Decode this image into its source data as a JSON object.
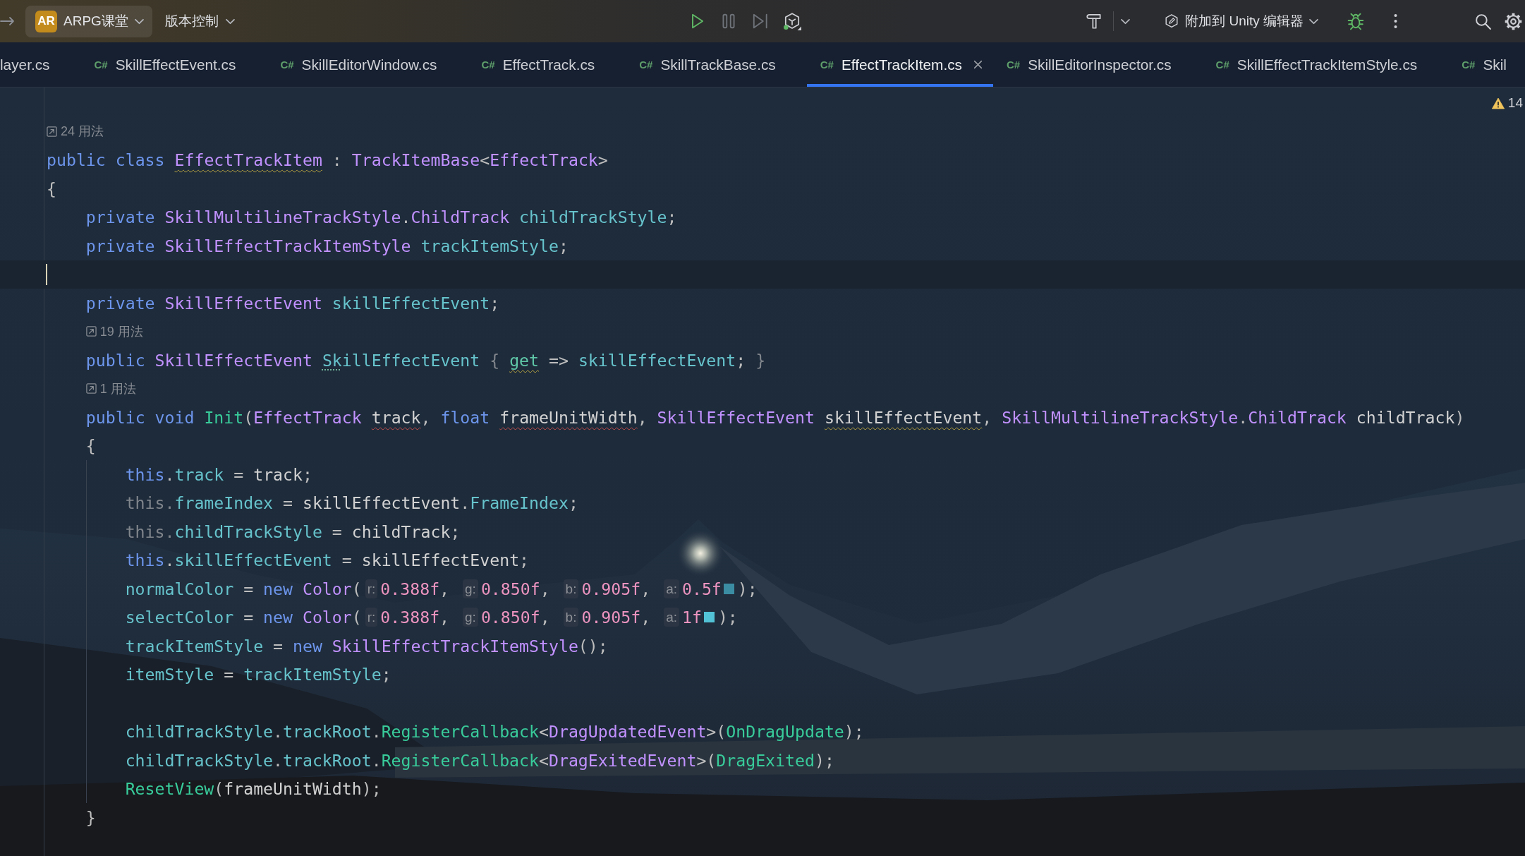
{
  "toolbar": {
    "project": {
      "initials": "AR",
      "name": "ARPG课堂"
    },
    "vcs_menu": "版本控制",
    "run_controls": [
      {
        "kind": "run",
        "disabled": false
      },
      {
        "kind": "pause",
        "disabled": true
      },
      {
        "kind": "step",
        "disabled": true
      }
    ],
    "run_configuration": "附加到 Unity 编辑器"
  },
  "tabs": [
    {
      "kind": "clipped",
      "label": "layer.cs",
      "selected": false
    },
    {
      "kind": "file",
      "file_type": "C#",
      "label": "SkillEffectEvent.cs",
      "selected": false
    },
    {
      "kind": "file",
      "file_type": "C#",
      "label": "SkillEditorWindow.cs",
      "selected": false
    },
    {
      "kind": "file",
      "file_type": "C#",
      "label": "EffectTrack.cs",
      "selected": false
    },
    {
      "kind": "file",
      "file_type": "C#",
      "label": "SkillTrackBase.cs",
      "selected": false
    },
    {
      "kind": "file",
      "file_type": "C#",
      "label": "EffectTrackItem.cs",
      "selected": true
    },
    {
      "kind": "file",
      "file_type": "C#",
      "label": "SkillEditorInspector.cs",
      "selected": false
    },
    {
      "kind": "file",
      "file_type": "C#",
      "label": "SkillEffectTrackItemStyle.cs",
      "selected": false
    },
    {
      "kind": "file",
      "file_type": "C#",
      "label": "Skil",
      "selected": false
    }
  ],
  "editor": {
    "warning_count": "14",
    "lines": [
      {
        "kind": "hint",
        "text": "24 用法"
      },
      {
        "kind": "code",
        "tokens": [
          {
            "text": "public ",
            "kind": "keyword"
          },
          {
            "text": "class ",
            "kind": "keyword"
          },
          {
            "text": "EffectTrackItem",
            "kind": "type",
            "underline": {
              "kind": "warning"
            }
          },
          {
            "text": " : ",
            "kind": "punct"
          },
          {
            "text": "TrackItemBase",
            "kind": "type"
          },
          {
            "text": "<",
            "kind": "punct"
          },
          {
            "text": "EffectTrack",
            "kind": "type"
          },
          {
            "text": ">",
            "kind": "punct"
          }
        ]
      },
      {
        "kind": "code",
        "tokens": [
          {
            "text": "{",
            "kind": "punct"
          }
        ],
        "children": [
          {
            "kind": "code",
            "tokens": [
              {
                "text": "private ",
                "kind": "keyword"
              },
              {
                "text": "SkillMultilineTrackStyle",
                "kind": "type"
              },
              {
                "text": ".",
                "kind": "punct"
              },
              {
                "text": "ChildTrack ",
                "kind": "type"
              },
              {
                "text": "childTrackStyle",
                "kind": "field"
              },
              {
                "text": ";",
                "kind": "punct"
              }
            ]
          },
          {
            "kind": "code",
            "tokens": [
              {
                "text": "private ",
                "kind": "keyword"
              },
              {
                "text": "SkillEffectTrackItemStyle ",
                "kind": "type"
              },
              {
                "text": "trackItemStyle",
                "kind": "field"
              },
              {
                "text": ";",
                "kind": "punct"
              }
            ]
          },
          {
            "kind": "blank",
            "caret": true
          },
          {
            "kind": "code",
            "tokens": [
              {
                "text": "private ",
                "kind": "keyword"
              },
              {
                "text": "SkillEffectEvent ",
                "kind": "type"
              },
              {
                "text": "skillEffectEvent",
                "kind": "field"
              },
              {
                "text": ";",
                "kind": "punct"
              }
            ]
          },
          {
            "kind": "hint",
            "text": "19 用法"
          },
          {
            "kind": "code",
            "tokens": [
              {
                "text": "public ",
                "kind": "keyword"
              },
              {
                "text": "SkillEffectEvent ",
                "kind": "type"
              },
              {
                "text": "Sk",
                "kind": "field",
                "underline": {
                  "kind": "dotted"
                }
              },
              {
                "text": "illEffectEvent ",
                "kind": "field"
              },
              {
                "text": "{ ",
                "kind": "dim"
              },
              {
                "text": "get",
                "kind": "accessor",
                "underline": {
                  "kind": "warning"
                }
              },
              {
                "text": " => ",
                "kind": "punct"
              },
              {
                "text": "skillEffectEvent",
                "kind": "field"
              },
              {
                "text": "; ",
                "kind": "punct"
              },
              {
                "text": "}",
                "kind": "dim"
              }
            ]
          },
          {
            "kind": "hint",
            "text": "1 用法"
          },
          {
            "kind": "code",
            "tokens": [
              {
                "text": "public ",
                "kind": "keyword"
              },
              {
                "text": "void ",
                "kind": "keyword"
              },
              {
                "text": "Init",
                "kind": "method"
              },
              {
                "text": "(",
                "kind": "punct"
              },
              {
                "text": "EffectTrack ",
                "kind": "type"
              },
              {
                "text": "track",
                "kind": "param",
                "underline": {
                  "kind": "error"
                }
              },
              {
                "text": ", ",
                "kind": "punct"
              },
              {
                "text": "float ",
                "kind": "keyword"
              },
              {
                "text": "frameUnitWidth",
                "kind": "param",
                "underline": {
                  "kind": "error"
                }
              },
              {
                "text": ", ",
                "kind": "punct"
              },
              {
                "text": "SkillEffectEvent ",
                "kind": "type"
              },
              {
                "text": "skillEffectEvent",
                "kind": "param",
                "underline": {
                  "kind": "warning"
                }
              },
              {
                "text": ", ",
                "kind": "punct"
              },
              {
                "text": "SkillMultilineTrackStyle",
                "kind": "type"
              },
              {
                "text": ".",
                "kind": "punct"
              },
              {
                "text": "ChildTrack ",
                "kind": "type"
              },
              {
                "text": "childTrack",
                "kind": "param"
              },
              {
                "text": ")",
                "kind": "punct"
              }
            ]
          },
          {
            "kind": "code",
            "tokens": [
              {
                "text": "{",
                "kind": "punct"
              }
            ],
            "children": [
              {
                "kind": "code",
                "tokens": [
                  {
                    "text": "this",
                    "kind": "keyword"
                  },
                  {
                    "text": ".",
                    "kind": "punct"
                  },
                  {
                    "text": "track",
                    "kind": "field"
                  },
                  {
                    "text": " = ",
                    "kind": "punct"
                  },
                  {
                    "text": "track",
                    "kind": "param"
                  },
                  {
                    "text": ";",
                    "kind": "punct"
                  }
                ]
              },
              {
                "kind": "code",
                "tokens": [
                  {
                    "text": "this.",
                    "kind": "dim"
                  },
                  {
                    "text": "frameIndex",
                    "kind": "field"
                  },
                  {
                    "text": " = ",
                    "kind": "punct"
                  },
                  {
                    "text": "skillEffectEvent",
                    "kind": "param"
                  },
                  {
                    "text": ".",
                    "kind": "punct"
                  },
                  {
                    "text": "FrameIndex",
                    "kind": "field"
                  },
                  {
                    "text": ";",
                    "kind": "punct"
                  }
                ]
              },
              {
                "kind": "code",
                "tokens": [
                  {
                    "text": "this.",
                    "kind": "dim"
                  },
                  {
                    "text": "childTrackStyle",
                    "kind": "field"
                  },
                  {
                    "text": " = ",
                    "kind": "punct"
                  },
                  {
                    "text": "childTrack",
                    "kind": "param"
                  },
                  {
                    "text": ";",
                    "kind": "punct"
                  }
                ]
              },
              {
                "kind": "code",
                "tokens": [
                  {
                    "text": "this",
                    "kind": "keyword"
                  },
                  {
                    "text": ".",
                    "kind": "punct"
                  },
                  {
                    "text": "skillEffectEvent",
                    "kind": "field"
                  },
                  {
                    "text": " = ",
                    "kind": "punct"
                  },
                  {
                    "text": "skillEffectEvent",
                    "kind": "param"
                  },
                  {
                    "text": ";",
                    "kind": "punct"
                  }
                ]
              },
              {
                "kind": "code",
                "tokens": [
                  {
                    "text": "normalColor",
                    "kind": "field"
                  },
                  {
                    "text": " = ",
                    "kind": "punct"
                  },
                  {
                    "text": "new ",
                    "kind": "keyword"
                  },
                  {
                    "text": "Color",
                    "kind": "type"
                  },
                  {
                    "text": "(",
                    "kind": "punct"
                  },
                  {
                    "text": "r:",
                    "kind": "inlay"
                  },
                  {
                    "text": "0.388f",
                    "kind": "number"
                  },
                  {
                    "text": ", ",
                    "kind": "punct"
                  },
                  {
                    "text": "g:",
                    "kind": "inlay"
                  },
                  {
                    "text": "0.850f",
                    "kind": "number"
                  },
                  {
                    "text": ", ",
                    "kind": "punct"
                  },
                  {
                    "text": "b:",
                    "kind": "inlay"
                  },
                  {
                    "text": "0.905f",
                    "kind": "number"
                  },
                  {
                    "text": ", ",
                    "kind": "punct"
                  },
                  {
                    "text": "a:",
                    "kind": "inlay"
                  },
                  {
                    "text": "0.5f",
                    "kind": "number"
                  },
                  {
                    "kind": "swatch",
                    "color": "#3b8da3"
                  },
                  {
                    "text": ");",
                    "kind": "punct"
                  }
                ]
              },
              {
                "kind": "code",
                "tokens": [
                  {
                    "text": "selectColor",
                    "kind": "field"
                  },
                  {
                    "text": " = ",
                    "kind": "punct"
                  },
                  {
                    "text": "new ",
                    "kind": "keyword"
                  },
                  {
                    "text": "Color",
                    "kind": "type"
                  },
                  {
                    "text": "(",
                    "kind": "punct"
                  },
                  {
                    "text": "r:",
                    "kind": "inlay"
                  },
                  {
                    "text": "0.388f",
                    "kind": "number"
                  },
                  {
                    "text": ", ",
                    "kind": "punct"
                  },
                  {
                    "text": "g:",
                    "kind": "inlay"
                  },
                  {
                    "text": "0.850f",
                    "kind": "number"
                  },
                  {
                    "text": ", ",
                    "kind": "punct"
                  },
                  {
                    "text": "b:",
                    "kind": "inlay"
                  },
                  {
                    "text": "0.905f",
                    "kind": "number"
                  },
                  {
                    "text": ", ",
                    "kind": "punct"
                  },
                  {
                    "text": "a:",
                    "kind": "inlay"
                  },
                  {
                    "text": "1f",
                    "kind": "number"
                  },
                  {
                    "kind": "swatch",
                    "color": "#52c3d6"
                  },
                  {
                    "text": ");",
                    "kind": "punct"
                  }
                ]
              },
              {
                "kind": "code",
                "tokens": [
                  {
                    "text": "trackItemStyle",
                    "kind": "field"
                  },
                  {
                    "text": " = ",
                    "kind": "punct"
                  },
                  {
                    "text": "new ",
                    "kind": "keyword"
                  },
                  {
                    "text": "SkillEffectTrackItemStyle",
                    "kind": "type"
                  },
                  {
                    "text": "();",
                    "kind": "punct"
                  }
                ]
              },
              {
                "kind": "code",
                "tokens": [
                  {
                    "text": "itemStyle",
                    "kind": "field"
                  },
                  {
                    "text": " = ",
                    "kind": "punct"
                  },
                  {
                    "text": "trackItemStyle",
                    "kind": "field"
                  },
                  {
                    "text": ";",
                    "kind": "punct"
                  }
                ]
              },
              {
                "kind": "blank",
                "caret": false
              },
              {
                "kind": "code",
                "tokens": [
                  {
                    "text": "childTrackStyle",
                    "kind": "field"
                  },
                  {
                    "text": ".",
                    "kind": "punct"
                  },
                  {
                    "text": "trackRoot",
                    "kind": "field"
                  },
                  {
                    "text": ".",
                    "kind": "punct"
                  },
                  {
                    "text": "RegisterCallback",
                    "kind": "method"
                  },
                  {
                    "text": "<",
                    "kind": "punct"
                  },
                  {
                    "text": "DragUpdatedEvent",
                    "kind": "type"
                  },
                  {
                    "text": ">(",
                    "kind": "punct"
                  },
                  {
                    "text": "OnDragUpdate",
                    "kind": "method"
                  },
                  {
                    "text": ");",
                    "kind": "punct"
                  }
                ]
              },
              {
                "kind": "code",
                "tokens": [
                  {
                    "text": "childTrackStyle",
                    "kind": "field"
                  },
                  {
                    "text": ".",
                    "kind": "punct"
                  },
                  {
                    "text": "trackRoot",
                    "kind": "field"
                  },
                  {
                    "text": ".",
                    "kind": "punct"
                  },
                  {
                    "text": "RegisterCallback",
                    "kind": "method"
                  },
                  {
                    "text": "<",
                    "kind": "punct"
                  },
                  {
                    "text": "DragExitedEvent",
                    "kind": "type"
                  },
                  {
                    "text": ">(",
                    "kind": "punct"
                  },
                  {
                    "text": "DragExited",
                    "kind": "method"
                  },
                  {
                    "text": ");",
                    "kind": "punct"
                  }
                ]
              },
              {
                "kind": "code",
                "tokens": [
                  {
                    "text": "ResetView",
                    "kind": "method"
                  },
                  {
                    "text": "(",
                    "kind": "punct"
                  },
                  {
                    "text": "frameUnitWidth",
                    "kind": "param"
                  },
                  {
                    "text": ");",
                    "kind": "punct"
                  }
                ]
              }
            ]
          },
          {
            "kind": "code",
            "tokens": [
              {
                "text": "}",
                "kind": "punct"
              }
            ]
          }
        ]
      }
    ]
  }
}
